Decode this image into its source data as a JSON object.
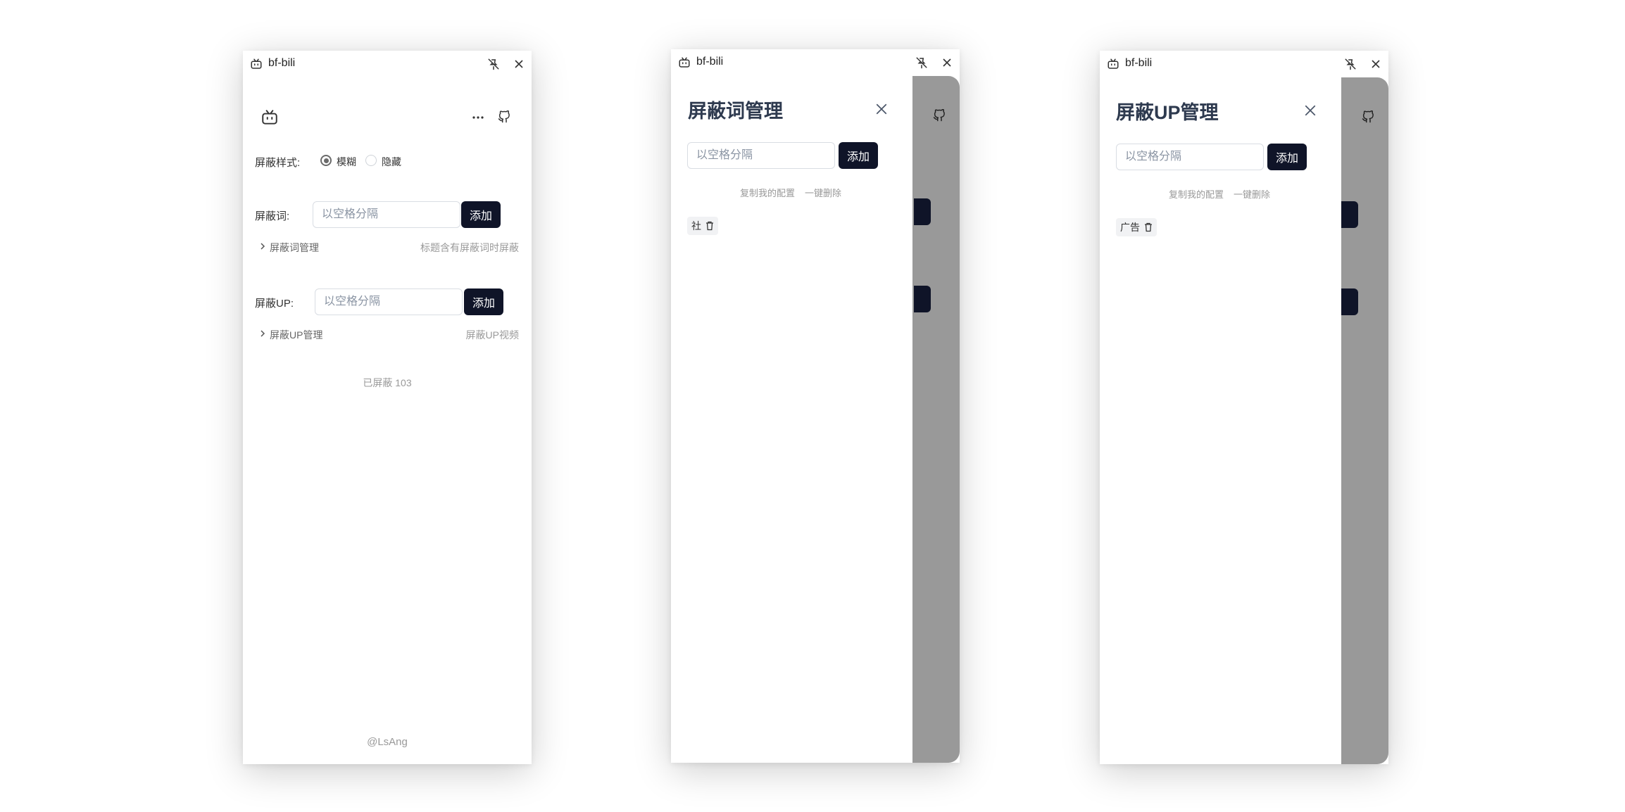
{
  "app": {
    "title": "bf-bili"
  },
  "main": {
    "style_label": "屏蔽样式:",
    "style_options": [
      "模糊",
      "隐藏"
    ],
    "selected_style": "模糊",
    "word_label": "屏蔽词:",
    "word_placeholder": "以空格分隔",
    "add_label": "添加",
    "word_manage": "屏蔽词管理",
    "word_hint": "标题含有屏蔽词时屏蔽",
    "up_label": "屏蔽UP:",
    "up_placeholder": "以空格分隔",
    "up_manage": "屏蔽UP管理",
    "up_hint": "屏蔽UP视频",
    "blocked_count": "已屏蔽 103",
    "footer": "@LsAng"
  },
  "word_drawer": {
    "title": "屏蔽词管理",
    "placeholder": "以空格分隔",
    "add_label": "添加",
    "copy_label": "复制我的配置",
    "delete_all_label": "一键删除",
    "items": [
      "社"
    ]
  },
  "up_drawer": {
    "title": "屏蔽UP管理",
    "placeholder": "以空格分隔",
    "add_label": "添加",
    "copy_label": "复制我的配置",
    "delete_all_label": "一键删除",
    "items": [
      "广告"
    ]
  },
  "icons": [
    "bilibili-icon",
    "pin-off-icon",
    "close-icon",
    "more-icon",
    "github-icon",
    "chevron-right-icon",
    "trash-icon"
  ]
}
